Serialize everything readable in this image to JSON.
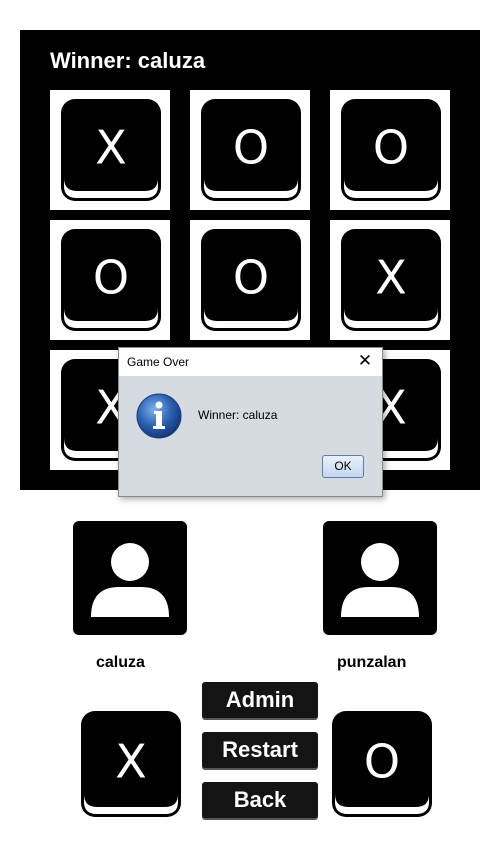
{
  "board": {
    "winner_text": "Winner: caluza",
    "cells": [
      "X",
      "O",
      "O",
      "O",
      "O",
      "X",
      "X",
      "",
      "X"
    ]
  },
  "dialog": {
    "title": "Game Over",
    "close_glyph": "✕",
    "message": "Winner: caluza",
    "ok_label": "OK",
    "icon": "info-icon"
  },
  "players": [
    {
      "name": "caluza",
      "mark": "X",
      "icon": "user-icon"
    },
    {
      "name": "punzalan",
      "mark": "O",
      "icon": "user-icon"
    }
  ],
  "controls": {
    "admin_label": "Admin",
    "restart_label": "Restart",
    "back_label": "Back"
  },
  "colors": {
    "board_bg": "#000000",
    "dialog_bg": "#d6dae1",
    "info_blue": "#2a5fb0"
  }
}
